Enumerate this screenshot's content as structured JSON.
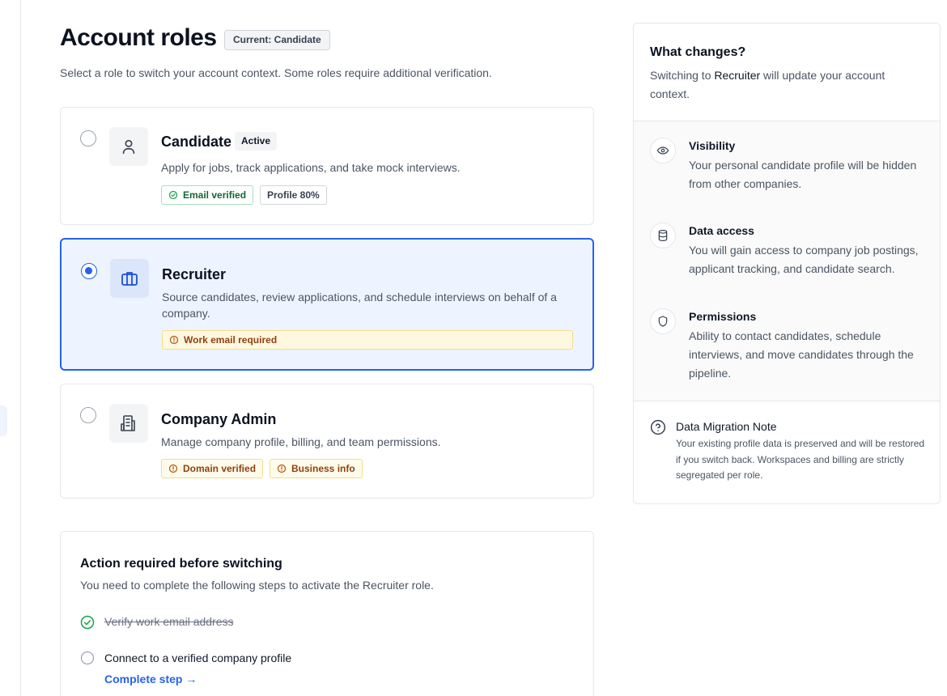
{
  "header": {
    "title": "Account roles",
    "current_badge": "Current: Candidate",
    "subtitle": "Select a role to switch your account context. Some roles require additional verification."
  },
  "roles": [
    {
      "name": "Candidate",
      "status": "Active",
      "description": "Apply for jobs, track applications, and take mock interviews.",
      "icon": "user-icon",
      "selected": false,
      "tags": [
        {
          "label": "Email verified",
          "tone": "green",
          "icon": "check-circle-icon"
        },
        {
          "label": "Profile 80%",
          "tone": "gray"
        }
      ]
    },
    {
      "name": "Recruiter",
      "description": "Source candidates, review applications, and schedule interviews on behalf of a company.",
      "icon": "briefcase-icon",
      "selected": true,
      "tags": [
        {
          "label": "Work email required",
          "tone": "amber",
          "icon": "alert-circle-icon"
        }
      ]
    },
    {
      "name": "Company Admin",
      "description": "Manage company profile, billing, and team permissions.",
      "icon": "building-icon",
      "selected": false,
      "tags": [
        {
          "label": "Domain verified",
          "tone": "amber",
          "icon": "alert-circle-icon"
        },
        {
          "label": "Business info",
          "tone": "amber",
          "icon": "alert-circle-icon"
        }
      ]
    }
  ],
  "action": {
    "title": "Action required before switching",
    "subtitle": "You need to complete the following steps to activate the Recruiter role.",
    "steps": [
      {
        "label": "Verify work email address",
        "done": true
      },
      {
        "label": "Connect to a verified company profile",
        "done": false,
        "link": "Complete step →"
      }
    ]
  },
  "side": {
    "title": "What changes?",
    "desc_prefix": "Switching to ",
    "desc_role": "Recruiter",
    "desc_suffix": " will update your account context.",
    "changes": [
      {
        "title": "Visibility",
        "icon": "eye-icon",
        "description": "Your personal candidate profile will be hidden from other companies."
      },
      {
        "title": "Data access",
        "icon": "database-icon",
        "description": "You will gain access to company job postings, applicant tracking, and candidate search."
      },
      {
        "title": "Permissions",
        "icon": "shield-icon",
        "description": "Ability to contact candidates, schedule interviews, and move candidates through the pipeline."
      }
    ],
    "note": {
      "title": "Data Migration Note",
      "icon": "help-circle-icon",
      "description": "Your existing profile data is preserved and will be restored if you switch back. Workspaces and billing are strictly segregated per role."
    }
  },
  "colors": {
    "accent": "#2563eb",
    "success": "#16a34a",
    "warning": "#b45309"
  }
}
